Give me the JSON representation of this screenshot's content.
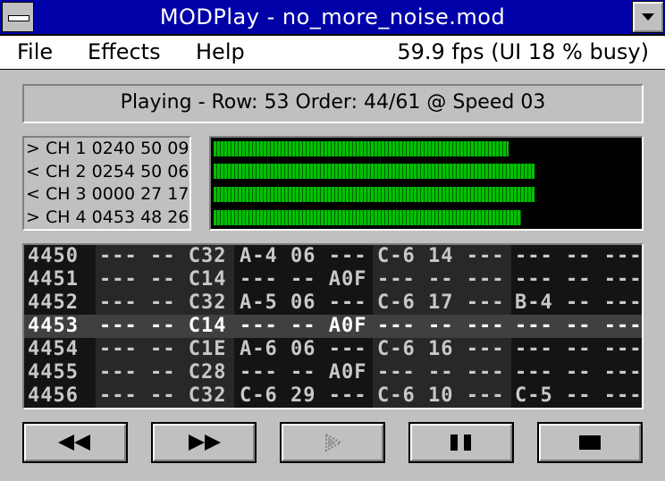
{
  "window": {
    "title": "MODPlay - no_more_noise.mod"
  },
  "menu": {
    "file": "File",
    "effects": "Effects",
    "help": "Help",
    "fps": "59.9 fps (UI 18 % busy)"
  },
  "status": "Playing - Row: 53 Order: 44/61 @ Speed 03",
  "channels": [
    "> CH 1 0240 50 09",
    "< CH 2 0254 50 06",
    "< CH 3 0000 27 17",
    "> CH 4 0453 48 26"
  ],
  "meter_levels_percent": [
    69,
    75,
    75,
    72
  ],
  "pattern": {
    "current_row_index": 3,
    "rows": [
      {
        "pos": "4450",
        "ch1": "--- -- C32",
        "ch2": "A-4 06 ---",
        "ch3": "C-6 14 ---",
        "ch4": "--- -- ---"
      },
      {
        "pos": "4451",
        "ch1": "--- -- C14",
        "ch2": "--- -- A0F",
        "ch3": "--- -- ---",
        "ch4": "--- -- ---"
      },
      {
        "pos": "4452",
        "ch1": "--- -- C32",
        "ch2": "A-5 06 ---",
        "ch3": "C-6 17 ---",
        "ch4": "B-4 -- ---"
      },
      {
        "pos": "4453",
        "ch1": "--- -- C14",
        "ch2": "--- -- A0F",
        "ch3": "--- -- ---",
        "ch4": "--- -- ---"
      },
      {
        "pos": "4454",
        "ch1": "--- -- C1E",
        "ch2": "A-6 06 ---",
        "ch3": "C-6 16 ---",
        "ch4": "--- -- ---"
      },
      {
        "pos": "4455",
        "ch1": "--- -- C28",
        "ch2": "--- -- A0F",
        "ch3": "--- -- ---",
        "ch4": "--- -- ---"
      },
      {
        "pos": "4456",
        "ch1": "--- -- C32",
        "ch2": "C-6 29 ---",
        "ch3": "C-6 10 ---",
        "ch4": "C-5 -- ---"
      }
    ]
  },
  "transport": [
    {
      "icon": "rewind-icon"
    },
    {
      "icon": "fast-forward-icon"
    },
    {
      "icon": "play-icon"
    },
    {
      "icon": "pause-icon"
    },
    {
      "icon": "stop-icon"
    }
  ],
  "colors": {
    "titlebar": "#0000a8",
    "meter": "#00c000",
    "face": "#c0c0c0"
  }
}
